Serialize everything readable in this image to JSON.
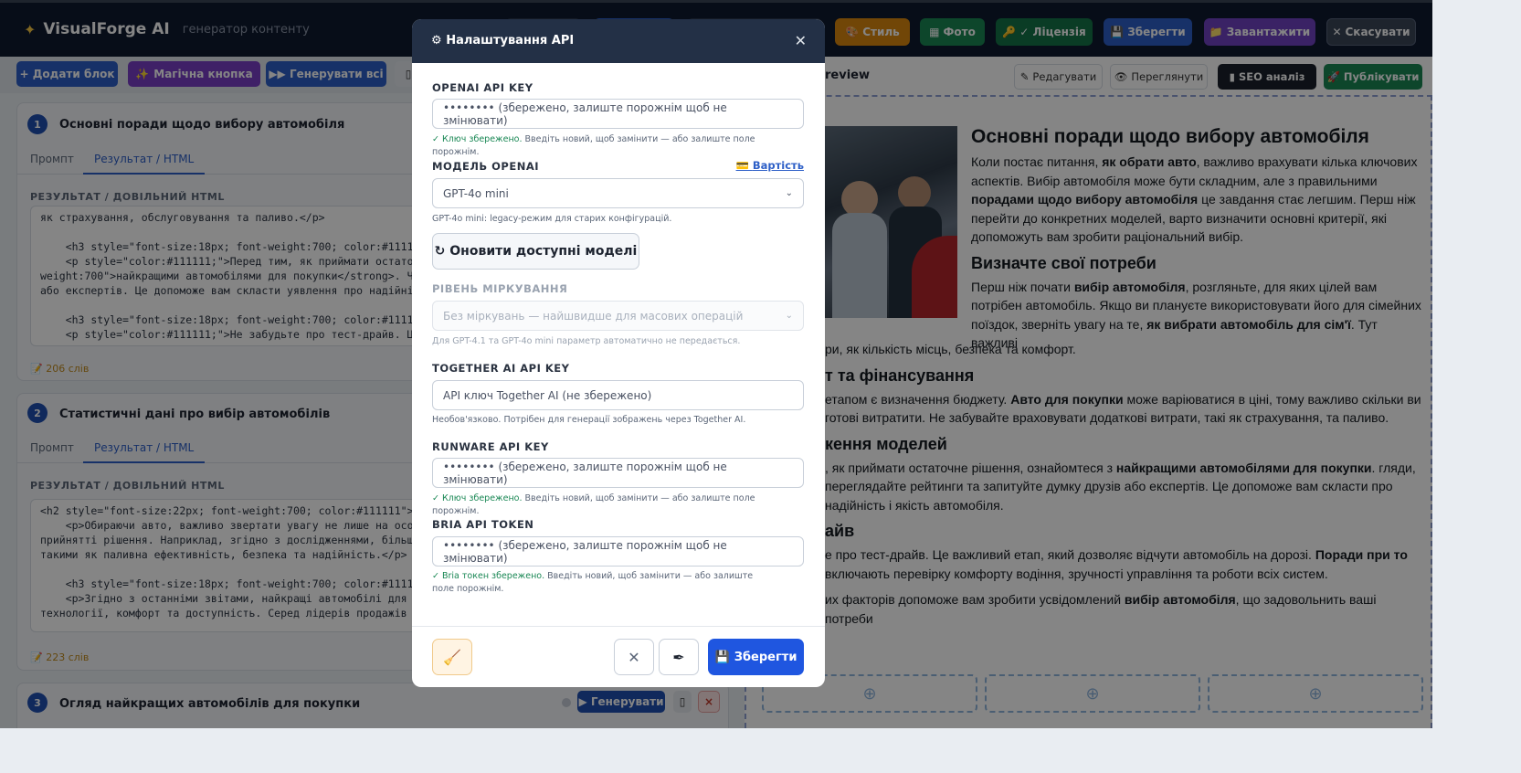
{
  "app": {
    "name": "VisualForge AI",
    "subtitle": "генератор контенту"
  },
  "topbar": {
    "buttons": [
      {
        "label": "Стиль",
        "icon": "palette-icon",
        "color": "#d9860f"
      },
      {
        "label": "Фото",
        "icon": "image-icon",
        "color": "#198754"
      },
      {
        "label": "✓ Ліцензія",
        "icon": "key-icon",
        "color": "#157347"
      },
      {
        "label": "Зберегти",
        "icon": "save-icon",
        "color": "#2d5fc7"
      },
      {
        "label": "Завантажити",
        "icon": "folder-icon",
        "color": "#6f42c1"
      },
      {
        "label": "Скасувати",
        "icon": "close-icon",
        "color": "#3a4556"
      }
    ]
  },
  "toolbar": {
    "add_block": "+ Додати блок",
    "magic": "Магічна кнопка",
    "generate_all": "▶▶ Генерувати всі"
  },
  "blocks": [
    {
      "num": "1",
      "title": "Основні поради щодо вибору автомобіля",
      "tab_prompt": "Промпт",
      "tab_result": "Результат / HTML",
      "section_label": "РЕЗУЛЬТАТ / ДОВІЛЬНИЙ HTML",
      "code": "як страхування, обслуговування та паливо.</p>\n\n    <h3 style=\"font-size:18px; font-weight:700; color:#111111;\">Дослідження м\n    <p style=\"color:#111111;\">Перед тим, як приймати остаточне рішення, о\nweight:700\">найкращими автомобілями для покупки</strong>. Читайте ог\nабо експертів. Це допоможе вам скласти уявлення про надійність і якість а\n\n    <h3 style=\"font-size:18px; font-weight:700; color:#111111;\">Тест-драйв</h3\n    <p style=\"color:#111111;\">Не забудьте про тест-драйв. Це важливий етап",
      "word_count": "206 слів"
    },
    {
      "num": "2",
      "title": "Статистичні дані про вибір автомобілів",
      "tab_prompt": "Промпт",
      "tab_result": "Результат / HTML",
      "section_label": "РЕЗУЛЬТАТ / ДОВІЛЬНИЙ HTML",
      "code": "<h2 style=\"font-size:22px; font-weight:700; color:#111111\">Статистичні дані п\n    <p>Обираючи авто, важливо звертати увагу не лише на особисті вподо\nприйнятті рішення. Наприклад, згідно з дослідженнями, більшість людей\nтакими як паливна ефективність, безпека та надійність.</p>\n\n    <h3 style=\"font-size:18px; font-weight:700; color:#111111\">Найпопулярніш\n    <p>Згідно з останніми звітами, найкращі автомобілі для покупки в Укра\nтехнології, комфорт та доступність. Серед лідерів продажів часто опиняют",
      "word_count": "223 слів"
    },
    {
      "num": "3",
      "title": "Огляд найкращих автомобілів для покупки",
      "generate": "▶ Генерувати",
      "delete": "×"
    }
  ],
  "preview": {
    "tab_label": "review",
    "edit": "Редагувати",
    "view": "Переглянути",
    "seo": "SEO аналіз",
    "publish": "Публікувати",
    "h1": "Основні поради щодо вибору автомобіля",
    "p1": "Коли постає питання, <b>як обрати авто</b>, важливо врахувати кілька ключових аспектів. Вибір автомобіля може бути складним, але з правильними <b>порадами щодо вибору автомобіля</b> це завдання стає легшим. Перш ніж перейти до конкретних моделей, варто визначити основні критерії, які допоможуть вам зробити раціональний вибір.",
    "h2a": "Визначте свої потреби",
    "p2": "Перш ніж почати <b>вибір автомобіля</b>, розгляньте, для яких цілей вам потрібен автомобіль. Якщо ви плануєте використовувати його для сімейних поїздок, зверніть увагу на те, <b>як вибрати автомобіль для сім'ї</b>. Тут важливі",
    "p2b": "ри, як кількість місць, безпека та комфорт.",
    "h2b": "т та фінансування",
    "p3": "етапом є визначення бюджету. <b>Авто для покупки</b> може варіюватися в ціні, тому важливо скільки ви готові витратити. Не забувайте враховувати додаткові витрати, такі як страхування, та паливо.",
    "h2c": "кення моделей",
    "p4": ", як приймати остаточне рішення, ознайомтеся з <b>найкращими автомобілями для покупки</b>. гляди, переглядайте рейтинги та запитуйте думку друзів або експертів. Це допоможе вам скласти про надійність і якість автомобіля.",
    "h2d": "айв",
    "p5": "е про тест-драйв. Це важливий етап, який дозволяє відчути автомобіль на дорозі. <b>Поради при</b> <b>то</b> включають перевірку комфорту водіння, зручності управління та роботи всіх систем.",
    "p6": "их факторів допоможе вам зробити усвідомлений <b>вибір автомобіля</b>, що задовольнить ваші потреби"
  },
  "modal": {
    "title": "Налаштування API",
    "openai_label": "OPENAI API KEY",
    "openai_value": "•••••••• (збережено, залиште порожнім щоб не змінювати)",
    "openai_hint_ok": "✓ Ключ збережено.",
    "openai_hint": " Введіть новий, щоб замінити — або залиште поле порожнім.",
    "model_label": "МОДЕЛЬ OPENAI",
    "cost_link": "Вартість",
    "model_value": "GPT-4o mini",
    "model_hint": "GPT-4o mini: legacy-режим для старих конфігурацій.",
    "refresh": "↻ Оновити доступні моделі",
    "reasoning_label": "РІВЕНЬ МІРКУВАННЯ",
    "reasoning_value": "Без міркувань — найшвидше для масових операцій",
    "reasoning_hint": "Для GPT-4.1 та GPT-4o mini параметр автоматично не передається.",
    "together_label": "TOGETHER AI API KEY",
    "together_placeholder": "API ключ Together AI (не збережено)",
    "together_hint": "Необов'язково. Потрібен для генерації зображень через Together AI.",
    "runware_label": "RUNWARE API KEY",
    "runware_value": "•••••••• (збережено, залиште порожнім щоб не змінювати)",
    "runware_hint_ok": "✓ Ключ збережено.",
    "runware_hint": " Введіть новий, щоб замінити — або залиште поле порожнім.",
    "bria_label": "BRIA API TOKEN",
    "bria_value": "•••••••• (збережено, залиште порожнім щоб не змінювати)",
    "bria_hint_ok": "✓ Bria токен збережено.",
    "bria_hint": " Введіть новий, щоб замінити — або залиште поле порожнім.",
    "save": "Зберегти"
  }
}
